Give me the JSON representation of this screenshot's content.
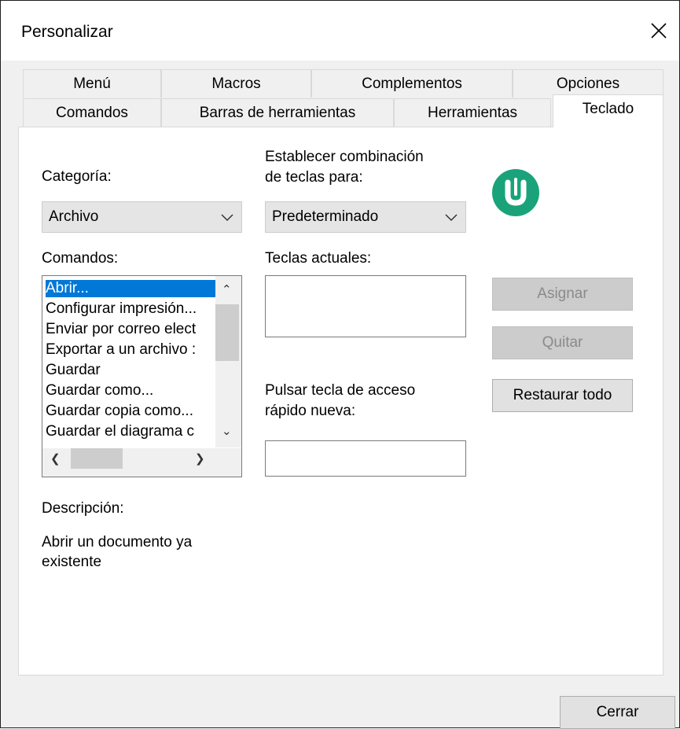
{
  "window": {
    "title": "Personalizar"
  },
  "tabs": {
    "row_back": [
      "Menú",
      "Macros",
      "Complementos",
      "Opciones"
    ],
    "row_front": [
      "Comandos",
      "Barras de herramientas",
      "Herramientas"
    ],
    "selected": "Teclado"
  },
  "category": {
    "label": "Categoría:",
    "value": "Archivo"
  },
  "commands": {
    "label": "Comandos:",
    "items": [
      "Abrir...",
      "Configurar impresión...",
      "Enviar por correo elect",
      "Exportar a un archivo :",
      "Guardar",
      "Guardar como...",
      "Guardar copia como...",
      "Guardar el diagrama c"
    ],
    "selected_index": 0
  },
  "keyset": {
    "label_line1": "Establecer combinación",
    "label_line2": "de teclas para:",
    "value": "Predeterminado"
  },
  "current_keys": {
    "label": "Teclas actuales:"
  },
  "new_shortcut": {
    "label_line1": "Pulsar tecla de acceso",
    "label_line2": "rápido nueva:",
    "value": ""
  },
  "buttons": {
    "assign": "Asignar",
    "remove": "Quitar",
    "reset_all": "Restaurar todo",
    "close": "Cerrar"
  },
  "description": {
    "label": "Descripción:",
    "text_line1": "Abrir un documento ya",
    "text_line2": "existente"
  },
  "colors": {
    "selection": "#0078d7",
    "logo": "#1aa37a"
  },
  "icons": {
    "close": "close-icon",
    "chevron": "chevron-down-icon",
    "logo": "app-logo"
  }
}
